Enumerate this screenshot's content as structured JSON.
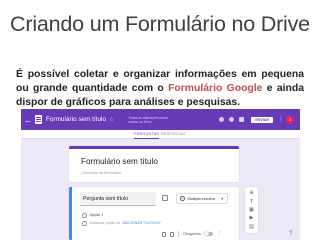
{
  "slide": {
    "title": "Criando um Formulário no Drive",
    "text_before": "É possível coletar e organizar informações em pequena ou grande quantidade com o ",
    "text_highlight": "Formulário Google",
    "text_after": " e ainda dispor de gráficos para análises e pesquisas."
  },
  "app": {
    "doc_title": "Formulário sem título",
    "save_note": "Todas as alterações foram salvas no Drive",
    "send_label": "ENVIAR",
    "avatar_initial": "J",
    "tabs": {
      "questions": "PERGUNTAS",
      "responses": "RESPOSTAS"
    },
    "form": {
      "title": "Formulário sem título",
      "description": "Descrição do formulário"
    },
    "question": {
      "title": "Pergunta sem título",
      "type": "Múltipla escolha",
      "option1": "Opção 1",
      "add_option": "Adicionar opção ou",
      "add_other": "ADICIONAR \"OUTROS\"",
      "required": "Obrigatória"
    },
    "colors": {
      "accent": "#673ab7",
      "question_bar": "#4285f4",
      "highlight": "#c0504d"
    }
  }
}
